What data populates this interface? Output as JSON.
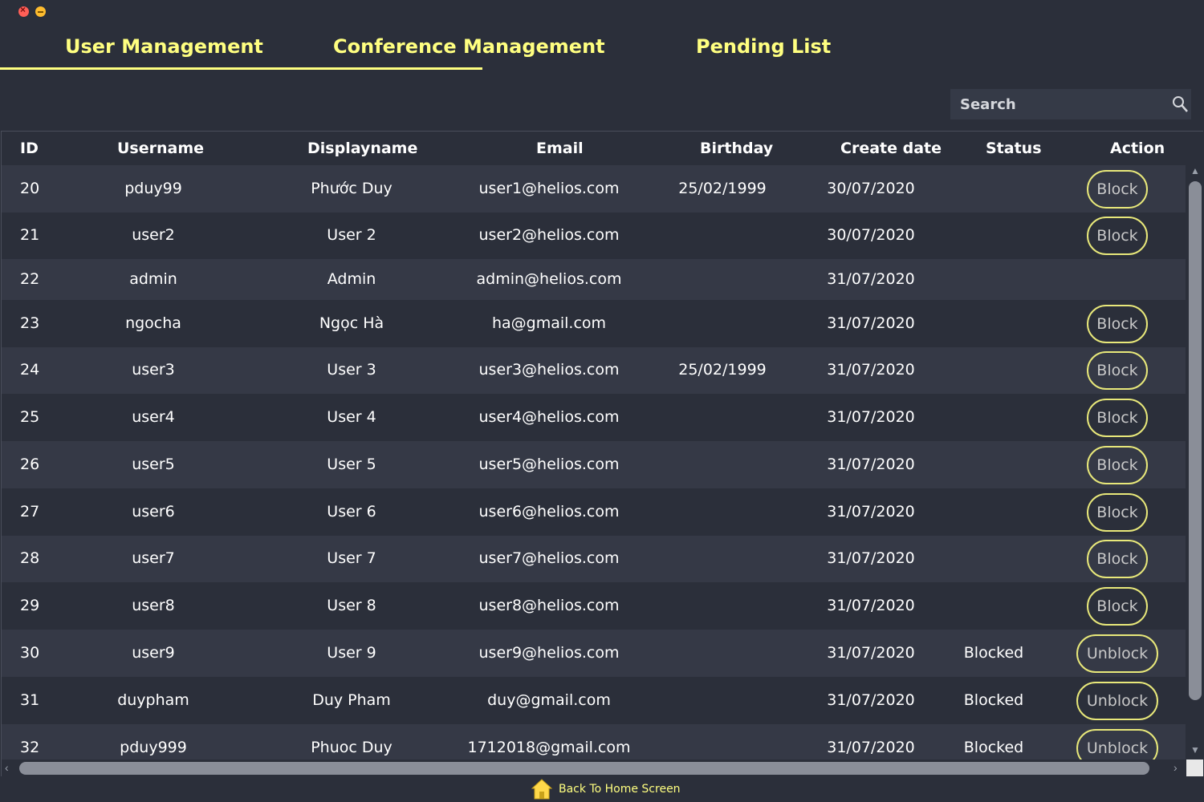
{
  "window": {
    "controls": [
      "close-icon",
      "minimize-icon"
    ]
  },
  "tabs": [
    {
      "label": "User Management",
      "active": true
    },
    {
      "label": "Conference Management",
      "active": false
    },
    {
      "label": "Pending List",
      "active": false
    }
  ],
  "search": {
    "placeholder": "Search",
    "value": "",
    "icon": "search-icon"
  },
  "table": {
    "columns": [
      "ID",
      "Username",
      "Displayname",
      "Email",
      "Birthday",
      "Create date",
      "Status",
      "Action"
    ],
    "rows": [
      {
        "id": "20",
        "username": "pduy99",
        "displayname": "Phước Duy",
        "email": "user1@helios.com",
        "birthday": "25/02/1999",
        "create_date": "30/07/2020",
        "status": "",
        "action": "Block"
      },
      {
        "id": "21",
        "username": "user2",
        "displayname": "User 2",
        "email": "user2@helios.com",
        "birthday": "",
        "create_date": "30/07/2020",
        "status": "",
        "action": "Block"
      },
      {
        "id": "22",
        "username": "admin",
        "displayname": "Admin",
        "email": "admin@helios.com",
        "birthday": "",
        "create_date": "31/07/2020",
        "status": "",
        "action": ""
      },
      {
        "id": "23",
        "username": "ngocha",
        "displayname": "Ngọc Hà",
        "email": "ha@gmail.com",
        "birthday": "",
        "create_date": "31/07/2020",
        "status": "",
        "action": "Block"
      },
      {
        "id": "24",
        "username": "user3",
        "displayname": "User 3",
        "email": "user3@helios.com",
        "birthday": "25/02/1999",
        "create_date": "31/07/2020",
        "status": "",
        "action": "Block"
      },
      {
        "id": "25",
        "username": "user4",
        "displayname": "User 4",
        "email": "user4@helios.com",
        "birthday": "",
        "create_date": "31/07/2020",
        "status": "",
        "action": "Block"
      },
      {
        "id": "26",
        "username": "user5",
        "displayname": "User 5",
        "email": "user5@helios.com",
        "birthday": "",
        "create_date": "31/07/2020",
        "status": "",
        "action": "Block"
      },
      {
        "id": "27",
        "username": "user6",
        "displayname": "User 6",
        "email": "user6@helios.com",
        "birthday": "",
        "create_date": "31/07/2020",
        "status": "",
        "action": "Block"
      },
      {
        "id": "28",
        "username": "user7",
        "displayname": "User 7",
        "email": "user7@helios.com",
        "birthday": "",
        "create_date": "31/07/2020",
        "status": "",
        "action": "Block"
      },
      {
        "id": "29",
        "username": "user8",
        "displayname": "User 8",
        "email": "user8@helios.com",
        "birthday": "",
        "create_date": "31/07/2020",
        "status": "",
        "action": "Block"
      },
      {
        "id": "30",
        "username": "user9",
        "displayname": "User 9",
        "email": "user9@helios.com",
        "birthday": "",
        "create_date": "31/07/2020",
        "status": "Blocked",
        "action": "Unblock"
      },
      {
        "id": "31",
        "username": "duypham",
        "displayname": "Duy Pham",
        "email": "duy@gmail.com",
        "birthday": "",
        "create_date": "31/07/2020",
        "status": "Blocked",
        "action": "Unblock"
      },
      {
        "id": "32",
        "username": "pduy999",
        "displayname": "Phuoc Duy",
        "email": "1712018@gmail.com",
        "birthday": "",
        "create_date": "31/07/2020",
        "status": "Blocked",
        "action": "Unblock"
      }
    ]
  },
  "footer": {
    "home_label": "Back To Home Screen",
    "home_icon": "home-icon"
  },
  "colors": {
    "background": "#2b2f3a",
    "row_alt": "#353946",
    "accent": "#ffff80",
    "button_border": "#e8e87a"
  }
}
